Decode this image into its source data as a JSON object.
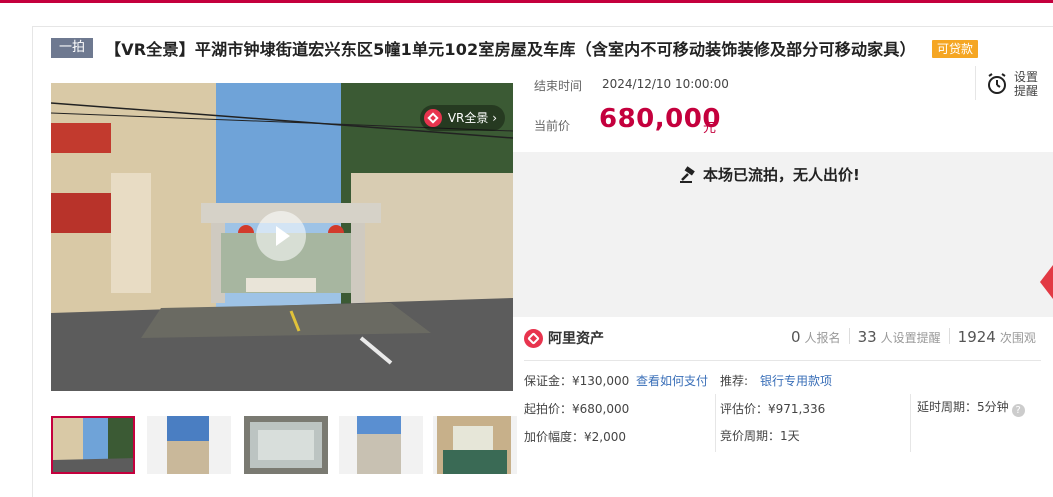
{
  "header": {
    "badge": "一拍",
    "title": "【VR全景】平湖市钟埭街道宏兴东区5幢1单元102室房屋及车库（含室内不可移动装饰装修及部分可移动家具）",
    "loan_tag": "可贷款"
  },
  "gallery": {
    "vr_label": "VR全景 ›"
  },
  "auction": {
    "end_label": "结束时间",
    "end_value": "2024/12/10 10:00:00",
    "reminder_label": "设置\n提醒",
    "price_label": "当前价",
    "price_value": "680,000",
    "price_unit": "元",
    "status_text": "本场已流拍，无人出价!"
  },
  "platform": {
    "name": "阿里资产"
  },
  "stats": [
    {
      "num": "0",
      "label": "人报名"
    },
    {
      "num": "33",
      "label": "人设置提醒"
    },
    {
      "num": "1924",
      "label": "次围观"
    }
  ],
  "details": {
    "deposit": "保证金：¥130,000",
    "how_to_pay": "查看如何支付",
    "recommend_label": "推荐:",
    "bank_link": "银行专用款项",
    "start_price": "起拍价：¥680,000",
    "eval_price": "评估价：¥971,336",
    "delay": "延时周期：5分钟",
    "increment": "加价幅度：¥2,000",
    "bid_cycle": "竞价周期：1天"
  },
  "colors": {
    "brand": "#c4003d",
    "loan": "#f5a623",
    "link": "#3a6fb8"
  }
}
